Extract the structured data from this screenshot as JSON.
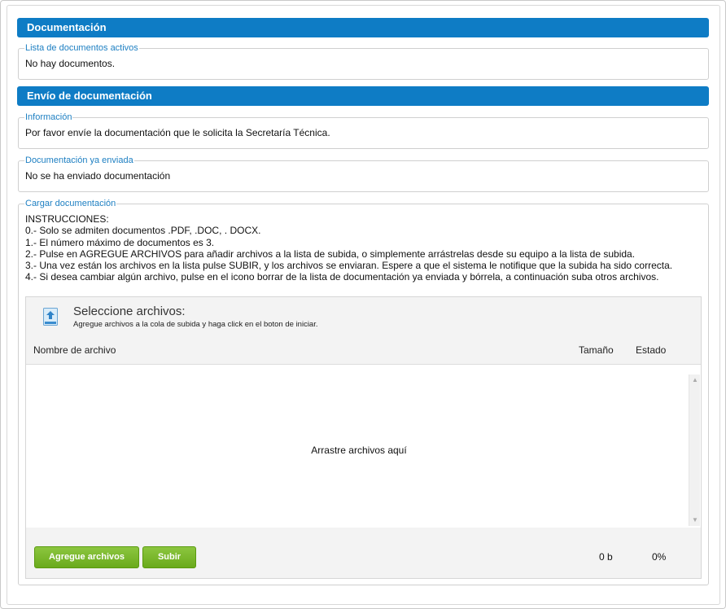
{
  "sections": {
    "documentacion": {
      "title": "Documentación",
      "active_list": {
        "legend": "Lista de documentos activos",
        "text": "No hay documentos."
      }
    },
    "envio": {
      "title": "Envío de documentación",
      "informacion": {
        "legend": "Información",
        "text": "Por favor envíe la documentación que le solicita la Secretaría Técnica."
      },
      "enviada": {
        "legend": "Documentación ya enviada",
        "text": "No se ha enviado documentación"
      },
      "cargar": {
        "legend": "Cargar documentación",
        "instructions": [
          "INSTRUCCIONES:",
          "0.- Solo se admiten documentos .PDF, .DOC, . DOCX.",
          "1.- El número máximo de documentos es 3.",
          "2.- Pulse en AGREGUE ARCHIVOS para añadir archivos a la lista de subida, o simplemente arrástrelas desde su equipo a la lista de subida.",
          "3.- Una vez están los archivos en la lista pulse SUBIR, y los archivos se enviaran. Espere a que el sistema le notifique que la subida ha sido correcta.",
          "4.- Si desea cambiar algún archivo, pulse en el icono borrar de la lista de documentación ya enviada y bórrela, a continuación suba otros archivos."
        ]
      }
    }
  },
  "uploader": {
    "icon": "upload-file-icon",
    "title": "Seleccione archivos:",
    "subtitle": "Agregue archivos a la cola de subida y haga click en el boton de iniciar.",
    "columns": {
      "name": "Nombre de archivo",
      "size": "Tamaño",
      "status": "Estado"
    },
    "drop_text": "Arrastre archivos aquí",
    "add_button": "Agregue archivos",
    "upload_button": "Subir",
    "total_size": "0 b",
    "total_percent": "0%"
  },
  "colors": {
    "section_bar": "#0e7cc5",
    "legend": "#1d7fc2",
    "button_green": "#7ab82c"
  }
}
